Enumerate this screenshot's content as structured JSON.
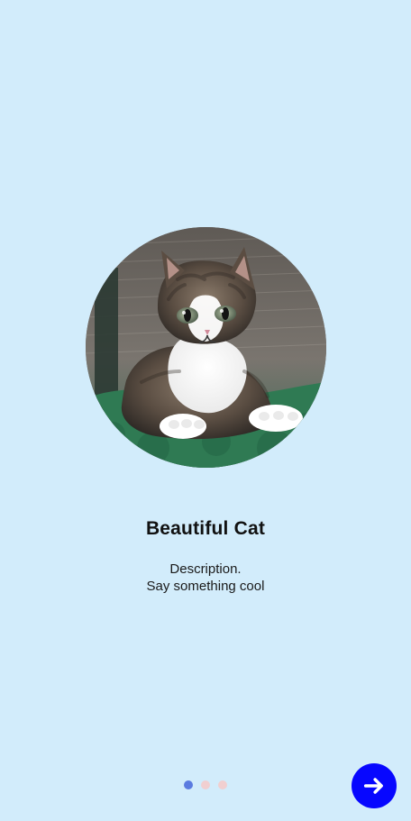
{
  "onboarding": {
    "title": "Beautiful Cat",
    "description_lines": [
      "Description.",
      "Say something cool"
    ],
    "image_icon": "cat-photo-icon"
  },
  "pager": {
    "active_index": 0,
    "count": 3
  },
  "next_button": {
    "icon": "arrow-right-icon"
  },
  "colors": {
    "background": "#d2ecfb",
    "dot_active": "#5b7be0",
    "dot_inactive": "#f1cfd0",
    "next_button_bg": "#0707ff",
    "next_button_icon": "#ffffff"
  }
}
